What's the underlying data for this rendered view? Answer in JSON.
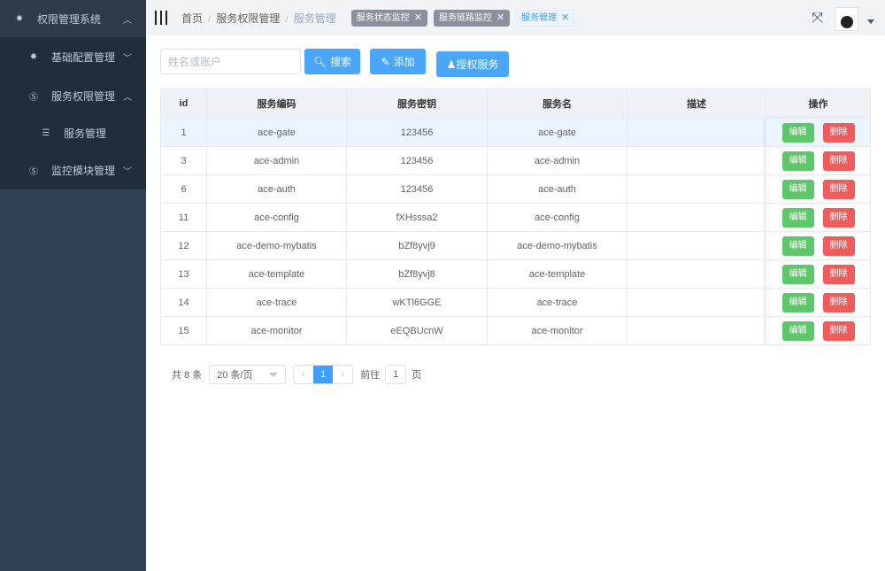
{
  "sidebar": {
    "items": [
      {
        "label": "权限管理系统",
        "icon": "gear-icon",
        "chevron": "up"
      },
      {
        "label": "基础配置管理",
        "icon": "gear-icon",
        "chevron": "down"
      },
      {
        "label": "服务权限管理",
        "icon": "service-icon",
        "chevron": "up"
      },
      {
        "label": "服务管理",
        "icon": "server-icon"
      },
      {
        "label": "监控模块管理",
        "icon": "service-icon",
        "chevron": "down"
      }
    ]
  },
  "header": {
    "breadcrumb": [
      "首页",
      "服务权限管理",
      "服务管理"
    ],
    "tags": [
      {
        "label": "服务状态监控"
      },
      {
        "label": "服务链路监控"
      },
      {
        "label": "服务管理"
      }
    ]
  },
  "toolbar": {
    "search_placeholder": "姓名或账户",
    "search": "搜索",
    "add": "添加",
    "authorize": "授权服务"
  },
  "table": {
    "columns": [
      "id",
      "服务编码",
      "服务密钥",
      "服务名",
      "描述",
      "操作"
    ],
    "rows": [
      [
        "1",
        "ace-gate",
        "123456",
        "ace-gate",
        ""
      ],
      [
        "3",
        "ace-admin",
        "123456",
        "ace-admin",
        ""
      ],
      [
        "6",
        "ace-auth",
        "123456",
        "ace-auth",
        ""
      ],
      [
        "11",
        "ace-config",
        "fXHsssa2",
        "ace-config",
        ""
      ],
      [
        "12",
        "ace-demo-mybatis",
        "bZf8yvj9",
        "ace-demo-mybatis",
        ""
      ],
      [
        "13",
        "ace-template",
        "bZf8yvj8",
        "ace-template",
        ""
      ],
      [
        "14",
        "ace-trace",
        "wKTl6GGE",
        "ace-trace",
        ""
      ],
      [
        "15",
        "ace-monitor",
        "eEQBUcnW",
        "ace-monitor",
        ""
      ]
    ],
    "edit": "编辑",
    "delete": "删除"
  },
  "pagination": {
    "total": "共 8 条",
    "page_size": "20 条/页",
    "current": "1",
    "goto": "前往",
    "goto_value": "1",
    "page_suffix": "页"
  }
}
